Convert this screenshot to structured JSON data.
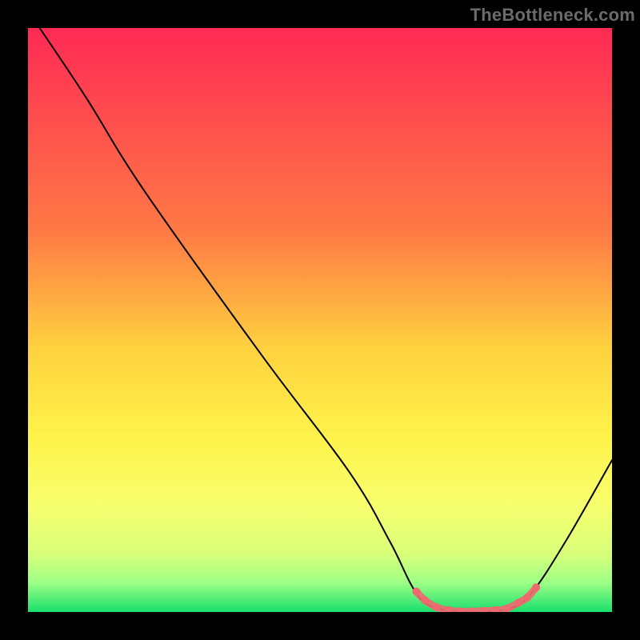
{
  "watermark": "TheBottleneck.com",
  "chart_data": {
    "type": "line",
    "title": "",
    "xlabel": "",
    "ylabel": "",
    "xlim": [
      0,
      100
    ],
    "ylim": [
      0,
      100
    ],
    "gradient_stops": [
      {
        "offset": 0,
        "color": "#ff2a55"
      },
      {
        "offset": 35,
        "color": "#ff7a45"
      },
      {
        "offset": 55,
        "color": "#ffd23f"
      },
      {
        "offset": 70,
        "color": "#fff34a"
      },
      {
        "offset": 82,
        "color": "#f7ff6e"
      },
      {
        "offset": 90,
        "color": "#d9ff7a"
      },
      {
        "offset": 95,
        "color": "#9dff86"
      },
      {
        "offset": 100,
        "color": "#18e06c"
      }
    ],
    "series": [
      {
        "name": "bottleneck-curve",
        "color": "#000000",
        "width": 2,
        "smooth": true,
        "points": [
          {
            "x": 2,
            "y": 100
          },
          {
            "x": 10,
            "y": 88
          },
          {
            "x": 20,
            "y": 72
          },
          {
            "x": 40,
            "y": 44
          },
          {
            "x": 55,
            "y": 24
          },
          {
            "x": 62,
            "y": 12
          },
          {
            "x": 66,
            "y": 4
          },
          {
            "x": 69,
            "y": 1
          },
          {
            "x": 75,
            "y": 0
          },
          {
            "x": 82,
            "y": 0.5
          },
          {
            "x": 86,
            "y": 3
          },
          {
            "x": 92,
            "y": 12
          },
          {
            "x": 100,
            "y": 26
          }
        ]
      },
      {
        "name": "optimal-range-markers",
        "color": "#ef6a6f",
        "marker_radius": 5,
        "points": [
          {
            "x": 66.5,
            "y": 3.5
          },
          {
            "x": 68,
            "y": 2
          },
          {
            "x": 70,
            "y": 0.8
          },
          {
            "x": 72,
            "y": 0.3
          },
          {
            "x": 74,
            "y": 0.1
          },
          {
            "x": 76,
            "y": 0.1
          },
          {
            "x": 78,
            "y": 0.2
          },
          {
            "x": 80,
            "y": 0.3
          },
          {
            "x": 82,
            "y": 0.6
          },
          {
            "x": 84,
            "y": 1.6
          },
          {
            "x": 85.5,
            "y": 2.5
          },
          {
            "x": 87,
            "y": 4.2
          }
        ]
      }
    ]
  }
}
